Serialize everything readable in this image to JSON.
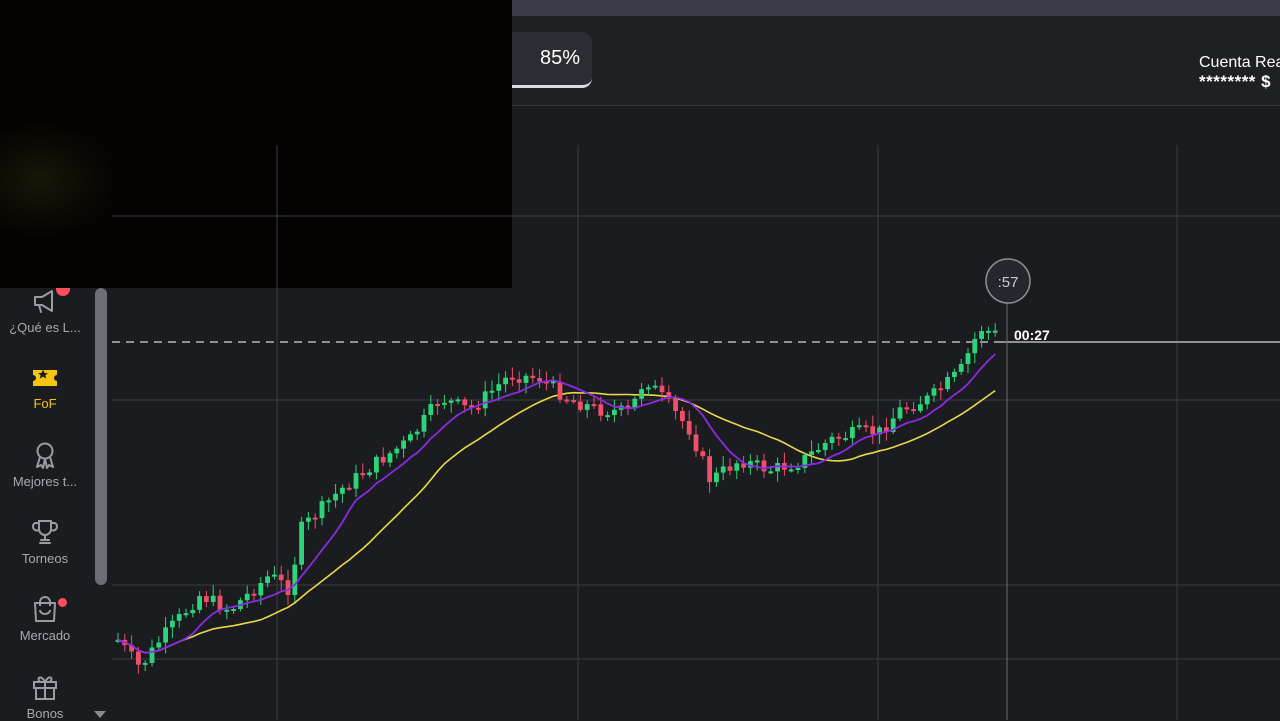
{
  "header": {
    "payout": "85%",
    "account_label": "Cuenta Rea",
    "account_balance": "******** $"
  },
  "sidebar": {
    "items": [
      {
        "label": "¿Qué es L...",
        "icon": "megaphone-icon",
        "badge": true
      },
      {
        "label": "FoF",
        "icon": "ticket-icon",
        "active": true
      },
      {
        "label": "Mejores t...",
        "icon": "ribbon-award-icon"
      },
      {
        "label": "Torneos",
        "icon": "trophy-icon"
      },
      {
        "label": "Mercado",
        "icon": "shopping-bag-icon",
        "badge": true
      },
      {
        "label": "Bonos",
        "icon": "gift-icon"
      }
    ]
  },
  "chart": {
    "timer_badge": ":57",
    "countdown_label": "00:27",
    "colors": {
      "up": "#2ed47a",
      "down": "#ef4f68",
      "ma_fast": "#8a2be2",
      "ma_slow": "#e8d94a",
      "grid": "#3a3c42",
      "background": "#1b1c20"
    }
  }
}
